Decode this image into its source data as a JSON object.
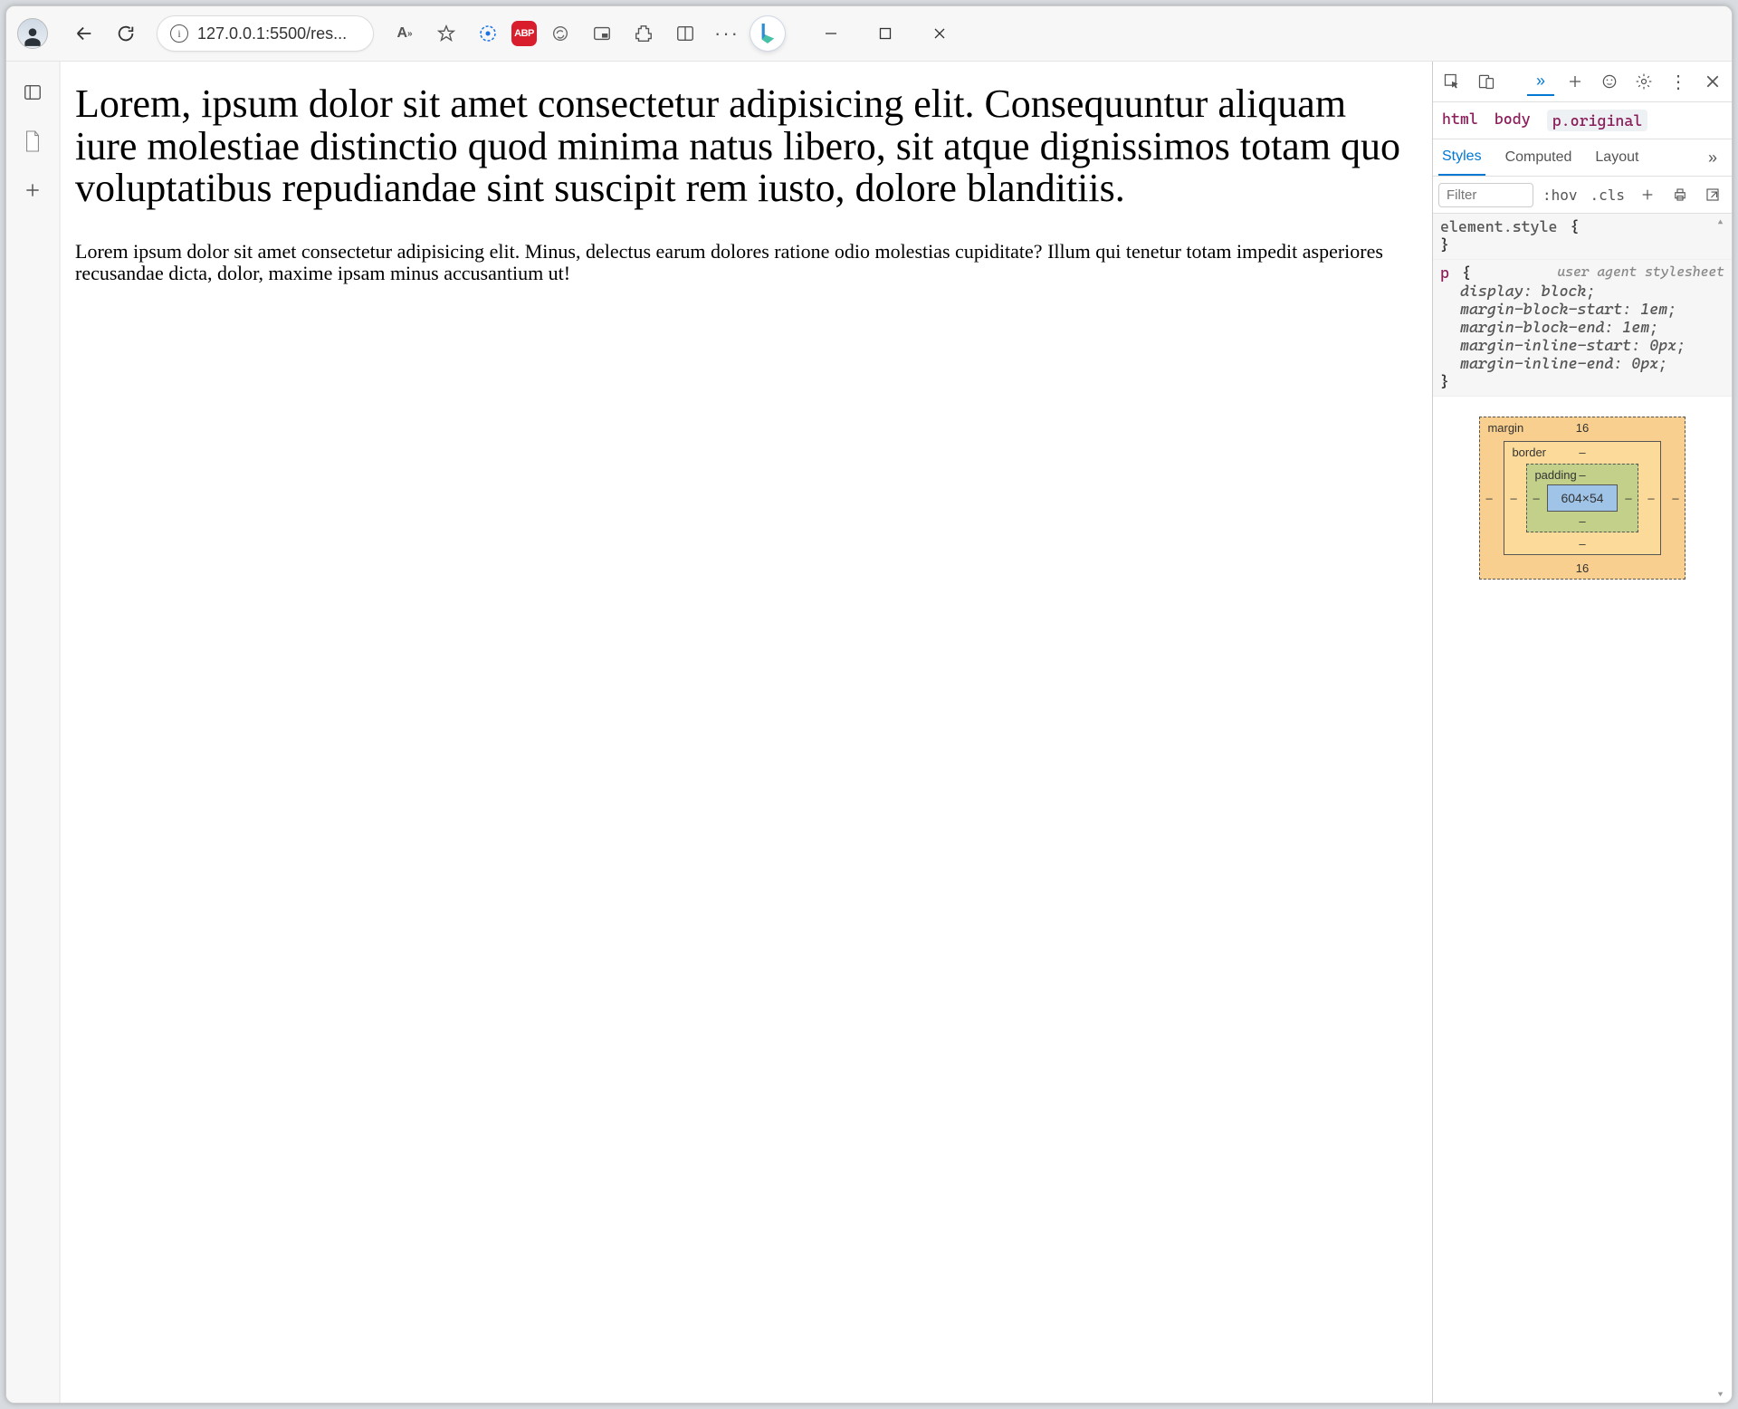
{
  "browser": {
    "url_display": "127.0.0.1:5500/res..."
  },
  "page": {
    "heading": "Lorem, ipsum dolor sit amet consectetur adipisicing elit. Consequuntur aliquam iure molestiae distinctio quod minima natus libero, sit atque dignissimos totam quo voluptatibus repudiandae sint suscipit rem iusto, dolore blanditiis.",
    "paragraph": "Lorem ipsum dolor sit amet consectetur adipisicing elit. Minus, delectus earum dolores ratione odio molestias cupiditate? Illum qui tenetur totam impedit asperiores recusandae dicta, dolor, maxime ipsam minus accusantium ut!"
  },
  "devtools": {
    "breadcrumbs": [
      "html",
      "body",
      "p.original"
    ],
    "breadcrumb_selected_index": 2,
    "tabs": [
      "Styles",
      "Computed",
      "Layout"
    ],
    "active_tab_index": 0,
    "filter_placeholder": "Filter",
    "toggle_hov": ":hov",
    "toggle_cls": ".cls",
    "element_style_selector": "element.style",
    "open_brace": "{",
    "close_brace": "}",
    "rule": {
      "selector_tag": "p",
      "source": "user agent stylesheet",
      "declarations": [
        {
          "prop": "display",
          "val": "block"
        },
        {
          "prop": "margin-block-start",
          "val": "1em"
        },
        {
          "prop": "margin-block-end",
          "val": "1em"
        },
        {
          "prop": "margin-inline-start",
          "val": "0px"
        },
        {
          "prop": "margin-inline-end",
          "val": "0px"
        }
      ]
    },
    "box_model": {
      "margin": {
        "label": "margin",
        "top": "16",
        "right": "–",
        "bottom": "16",
        "left": "–"
      },
      "border": {
        "label": "border",
        "top": "–",
        "right": "–",
        "bottom": "–",
        "left": "–"
      },
      "padding": {
        "label": "padding",
        "top": "–",
        "right": "–",
        "bottom": "–",
        "left": "–"
      },
      "content": "604×54"
    }
  }
}
